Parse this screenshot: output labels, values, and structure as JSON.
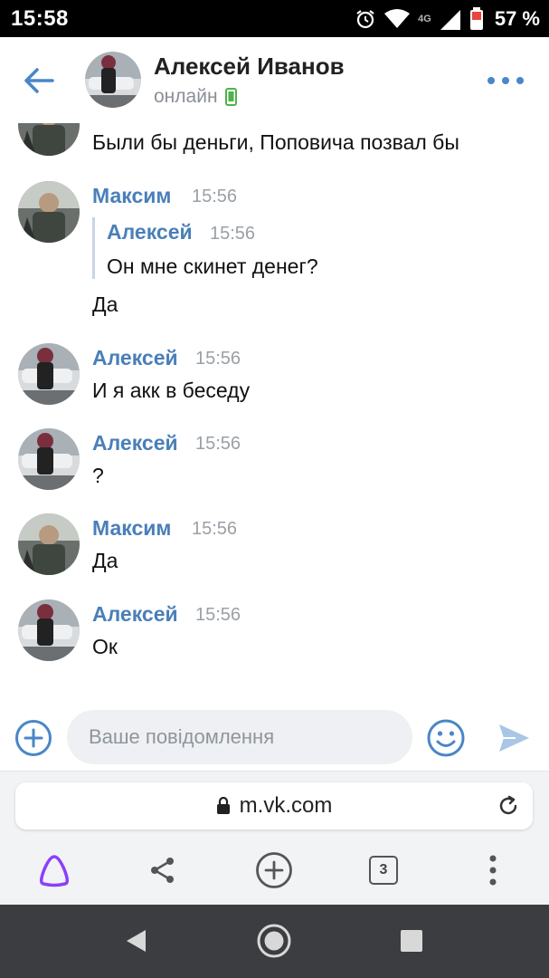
{
  "status_bar": {
    "time": "15:58",
    "network": "4G",
    "battery": "57 %"
  },
  "header": {
    "contact_name": "Алексей Иванов",
    "status": "онлайн",
    "back_icon": "arrow-left-icon",
    "more_icon": "more-dots-icon"
  },
  "messages": [
    {
      "author": "",
      "time": "",
      "text": "Были бы деньги, Поповича позвал бы",
      "avatar": "maxim"
    },
    {
      "author": "Максим",
      "time": "15:56",
      "quote": {
        "author": "Алексей",
        "time": "15:56",
        "text": "Он мне скинет денег?"
      },
      "text": "Да",
      "avatar": "maxim"
    },
    {
      "author": "Алексей",
      "time": "15:56",
      "text": "И я акк в беседу",
      "avatar": "aleksey"
    },
    {
      "author": "Алексей",
      "time": "15:56",
      "text": "?",
      "avatar": "aleksey"
    },
    {
      "author": "Максим",
      "time": "15:56",
      "text": "Да",
      "avatar": "maxim"
    },
    {
      "author": "Алексей",
      "time": "15:56",
      "text": "Ок",
      "avatar": "aleksey"
    }
  ],
  "composer": {
    "placeholder": "Ваше повідомлення"
  },
  "browser": {
    "url": "m.vk.com",
    "tabs_count": "3"
  },
  "colors": {
    "accent": "#4a86c8",
    "author": "#4a7fb8",
    "online": "#4bb34b",
    "alice": "#8a3ffc"
  }
}
